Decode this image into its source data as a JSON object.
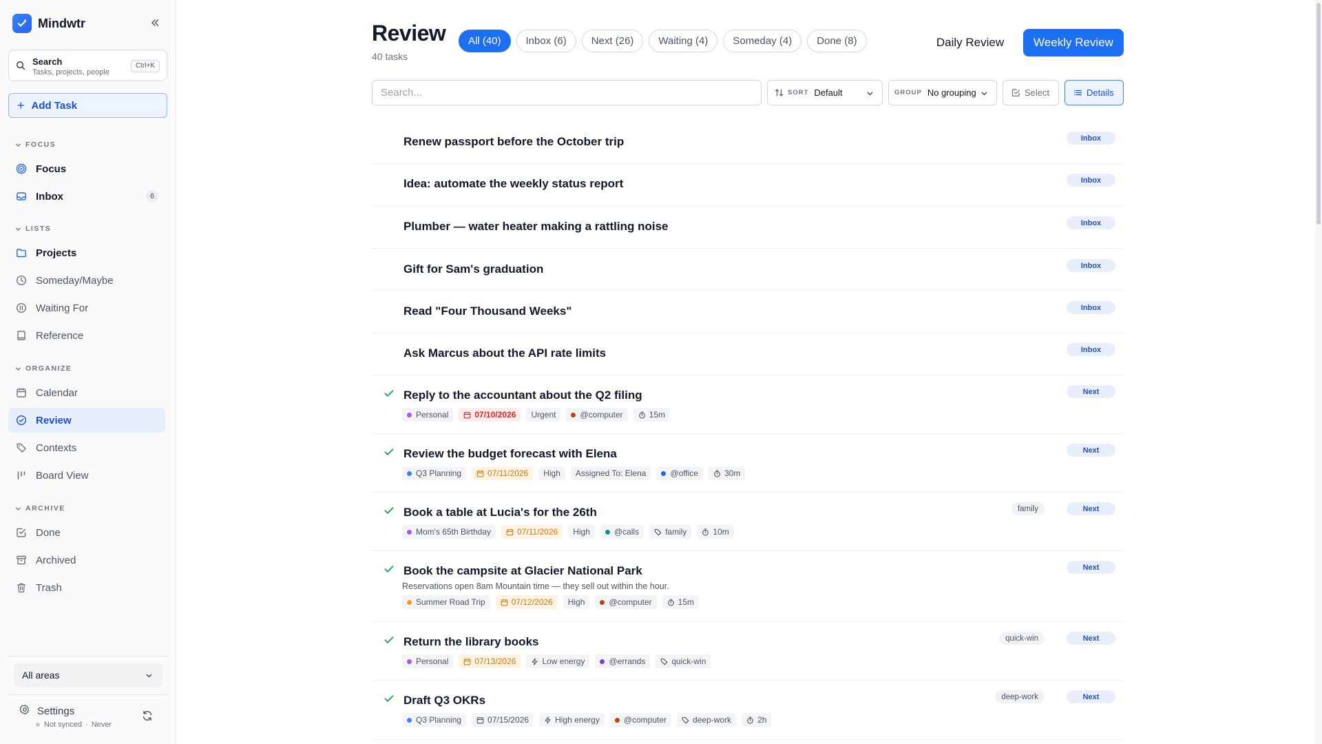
{
  "app": {
    "name": "Mindwtr"
  },
  "colors": {
    "accent": "#1d6ff2",
    "done_check": "#16a34a",
    "urgent": "#dc2626",
    "soon": "#d97706"
  },
  "sidebar": {
    "search": {
      "title": "Search",
      "subtitle": "Tasks, projects, people",
      "shortcut": "Ctrl+K"
    },
    "add_task": "Add Task",
    "sections": {
      "focus": "FOCUS",
      "lists": "LISTS",
      "organize": "ORGANIZE",
      "archive": "ARCHIVE"
    },
    "items": {
      "focus": {
        "label": "Focus",
        "icon": "target-icon"
      },
      "inbox": {
        "label": "Inbox",
        "icon": "inbox-icon",
        "count": "6"
      },
      "projects": {
        "label": "Projects",
        "icon": "folder-icon"
      },
      "someday": {
        "label": "Someday/Maybe",
        "icon": "clock-icon"
      },
      "waiting": {
        "label": "Waiting For",
        "icon": "pause-icon"
      },
      "reference": {
        "label": "Reference",
        "icon": "book-icon"
      },
      "calendar": {
        "label": "Calendar",
        "icon": "calendar-icon"
      },
      "review": {
        "label": "Review",
        "icon": "check-circle-icon",
        "active": true
      },
      "contexts": {
        "label": "Contexts",
        "icon": "tag-icon"
      },
      "board": {
        "label": "Board View",
        "icon": "board-icon"
      },
      "done": {
        "label": "Done",
        "icon": "check-square-icon"
      },
      "archived": {
        "label": "Archived",
        "icon": "archive-icon"
      },
      "trash": {
        "label": "Trash",
        "icon": "trash-icon"
      }
    },
    "area_select": "All areas",
    "settings": "Settings",
    "sync": {
      "status": "Not synced",
      "last": "Never",
      "separator": "·"
    }
  },
  "main": {
    "title": "Review",
    "subtitle": "40 tasks",
    "tabs": [
      {
        "label": "All (40)",
        "active": true
      },
      {
        "label": "Inbox (6)"
      },
      {
        "label": "Next (26)"
      },
      {
        "label": "Waiting (4)"
      },
      {
        "label": "Someday (4)"
      },
      {
        "label": "Done (8)"
      }
    ],
    "daily_review": "Daily Review",
    "weekly_review": "Weekly Review",
    "search_placeholder": "Search...",
    "sort": {
      "label": "SORT",
      "value": "Default"
    },
    "group": {
      "label": "GROUP",
      "value": "No grouping"
    },
    "select": "Select",
    "details": "Details"
  },
  "tasks": [
    {
      "title": "Renew passport before the October trip",
      "status": "Inbox"
    },
    {
      "title": "Idea: automate the weekly status report",
      "status": "Inbox"
    },
    {
      "title": "Plumber — water heater making a rattling noise",
      "status": "Inbox"
    },
    {
      "title": "Gift for Sam's graduation",
      "status": "Inbox"
    },
    {
      "title": "Read \"Four Thousand Weeks\"",
      "status": "Inbox"
    },
    {
      "title": "Ask Marcus about the API rate limits",
      "status": "Inbox"
    },
    {
      "title": "Reply to the accountant about the Q2 filing",
      "status": "Next",
      "done": true,
      "project": "Personal",
      "project_color": "#a855f7",
      "due": "07/10/2026",
      "due_style": "red",
      "priority": "Urgent",
      "context": "@computer",
      "context_color": "#c2410c",
      "time": "15m"
    },
    {
      "title": "Review the budget forecast with Elena",
      "status": "Next",
      "done": true,
      "project": "Q3 Planning",
      "project_color": "#3b82f6",
      "due": "07/11/2026",
      "due_style": "orange",
      "priority": "High",
      "assigned": "Assigned To: Elena",
      "context": "@office",
      "context_color": "#2563eb",
      "time": "30m"
    },
    {
      "title": "Book a table at Lucia's for the 26th",
      "status": "Next",
      "done": true,
      "tag": "family",
      "project": "Mom's 65th Birthday",
      "project_color": "#a855f7",
      "due": "07/11/2026",
      "due_style": "orange",
      "priority": "High",
      "context": "@calls",
      "context_color": "#0d9488",
      "label": "family",
      "time": "10m"
    },
    {
      "title": "Book the campsite at Glacier National Park",
      "status": "Next",
      "done": true,
      "desc": "Reservations open 8am Mountain time — they sell out within the hour.",
      "project": "Summer Road Trip",
      "project_color": "#f59e0b",
      "due": "07/12/2026",
      "due_style": "orange",
      "priority": "High",
      "context": "@computer",
      "context_color": "#c2410c",
      "time": "15m"
    },
    {
      "title": "Return the library books",
      "status": "Next",
      "done": true,
      "tag": "quick-win",
      "project": "Personal",
      "project_color": "#a855f7",
      "due": "07/13/2026",
      "due_style": "orange",
      "energy": "Low energy",
      "context": "@errands",
      "context_color": "#7c3aed",
      "label": "quick-win"
    },
    {
      "title": "Draft Q3 OKRs",
      "status": "Next",
      "done": true,
      "tag": "deep-work",
      "project": "Q3 Planning",
      "project_color": "#3b82f6",
      "due": "07/15/2026",
      "due_style": "plain",
      "energy": "High energy",
      "context": "@computer",
      "context_color": "#c2410c",
      "label": "deep-work",
      "time": "2h"
    }
  ]
}
